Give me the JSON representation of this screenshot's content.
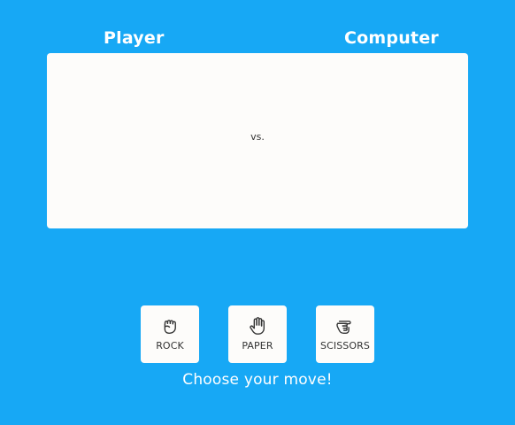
{
  "players": {
    "player_label": "Player",
    "computer_label": "Computer"
  },
  "arena": {
    "vs_text": "vs."
  },
  "choices": [
    {
      "id": "rock",
      "label": "ROCK",
      "icon": "fist-icon"
    },
    {
      "id": "paper",
      "label": "PAPER",
      "icon": "open-hand-icon"
    },
    {
      "id": "scissors",
      "label": "SCISSORS",
      "icon": "scissors-hand-icon"
    }
  ],
  "prompt": {
    "text": "Choose your move!"
  },
  "colors": {
    "background": "#17a8f5",
    "panel": "#fdfcfa",
    "text_light": "#ffffff",
    "text_dark": "#333333"
  }
}
